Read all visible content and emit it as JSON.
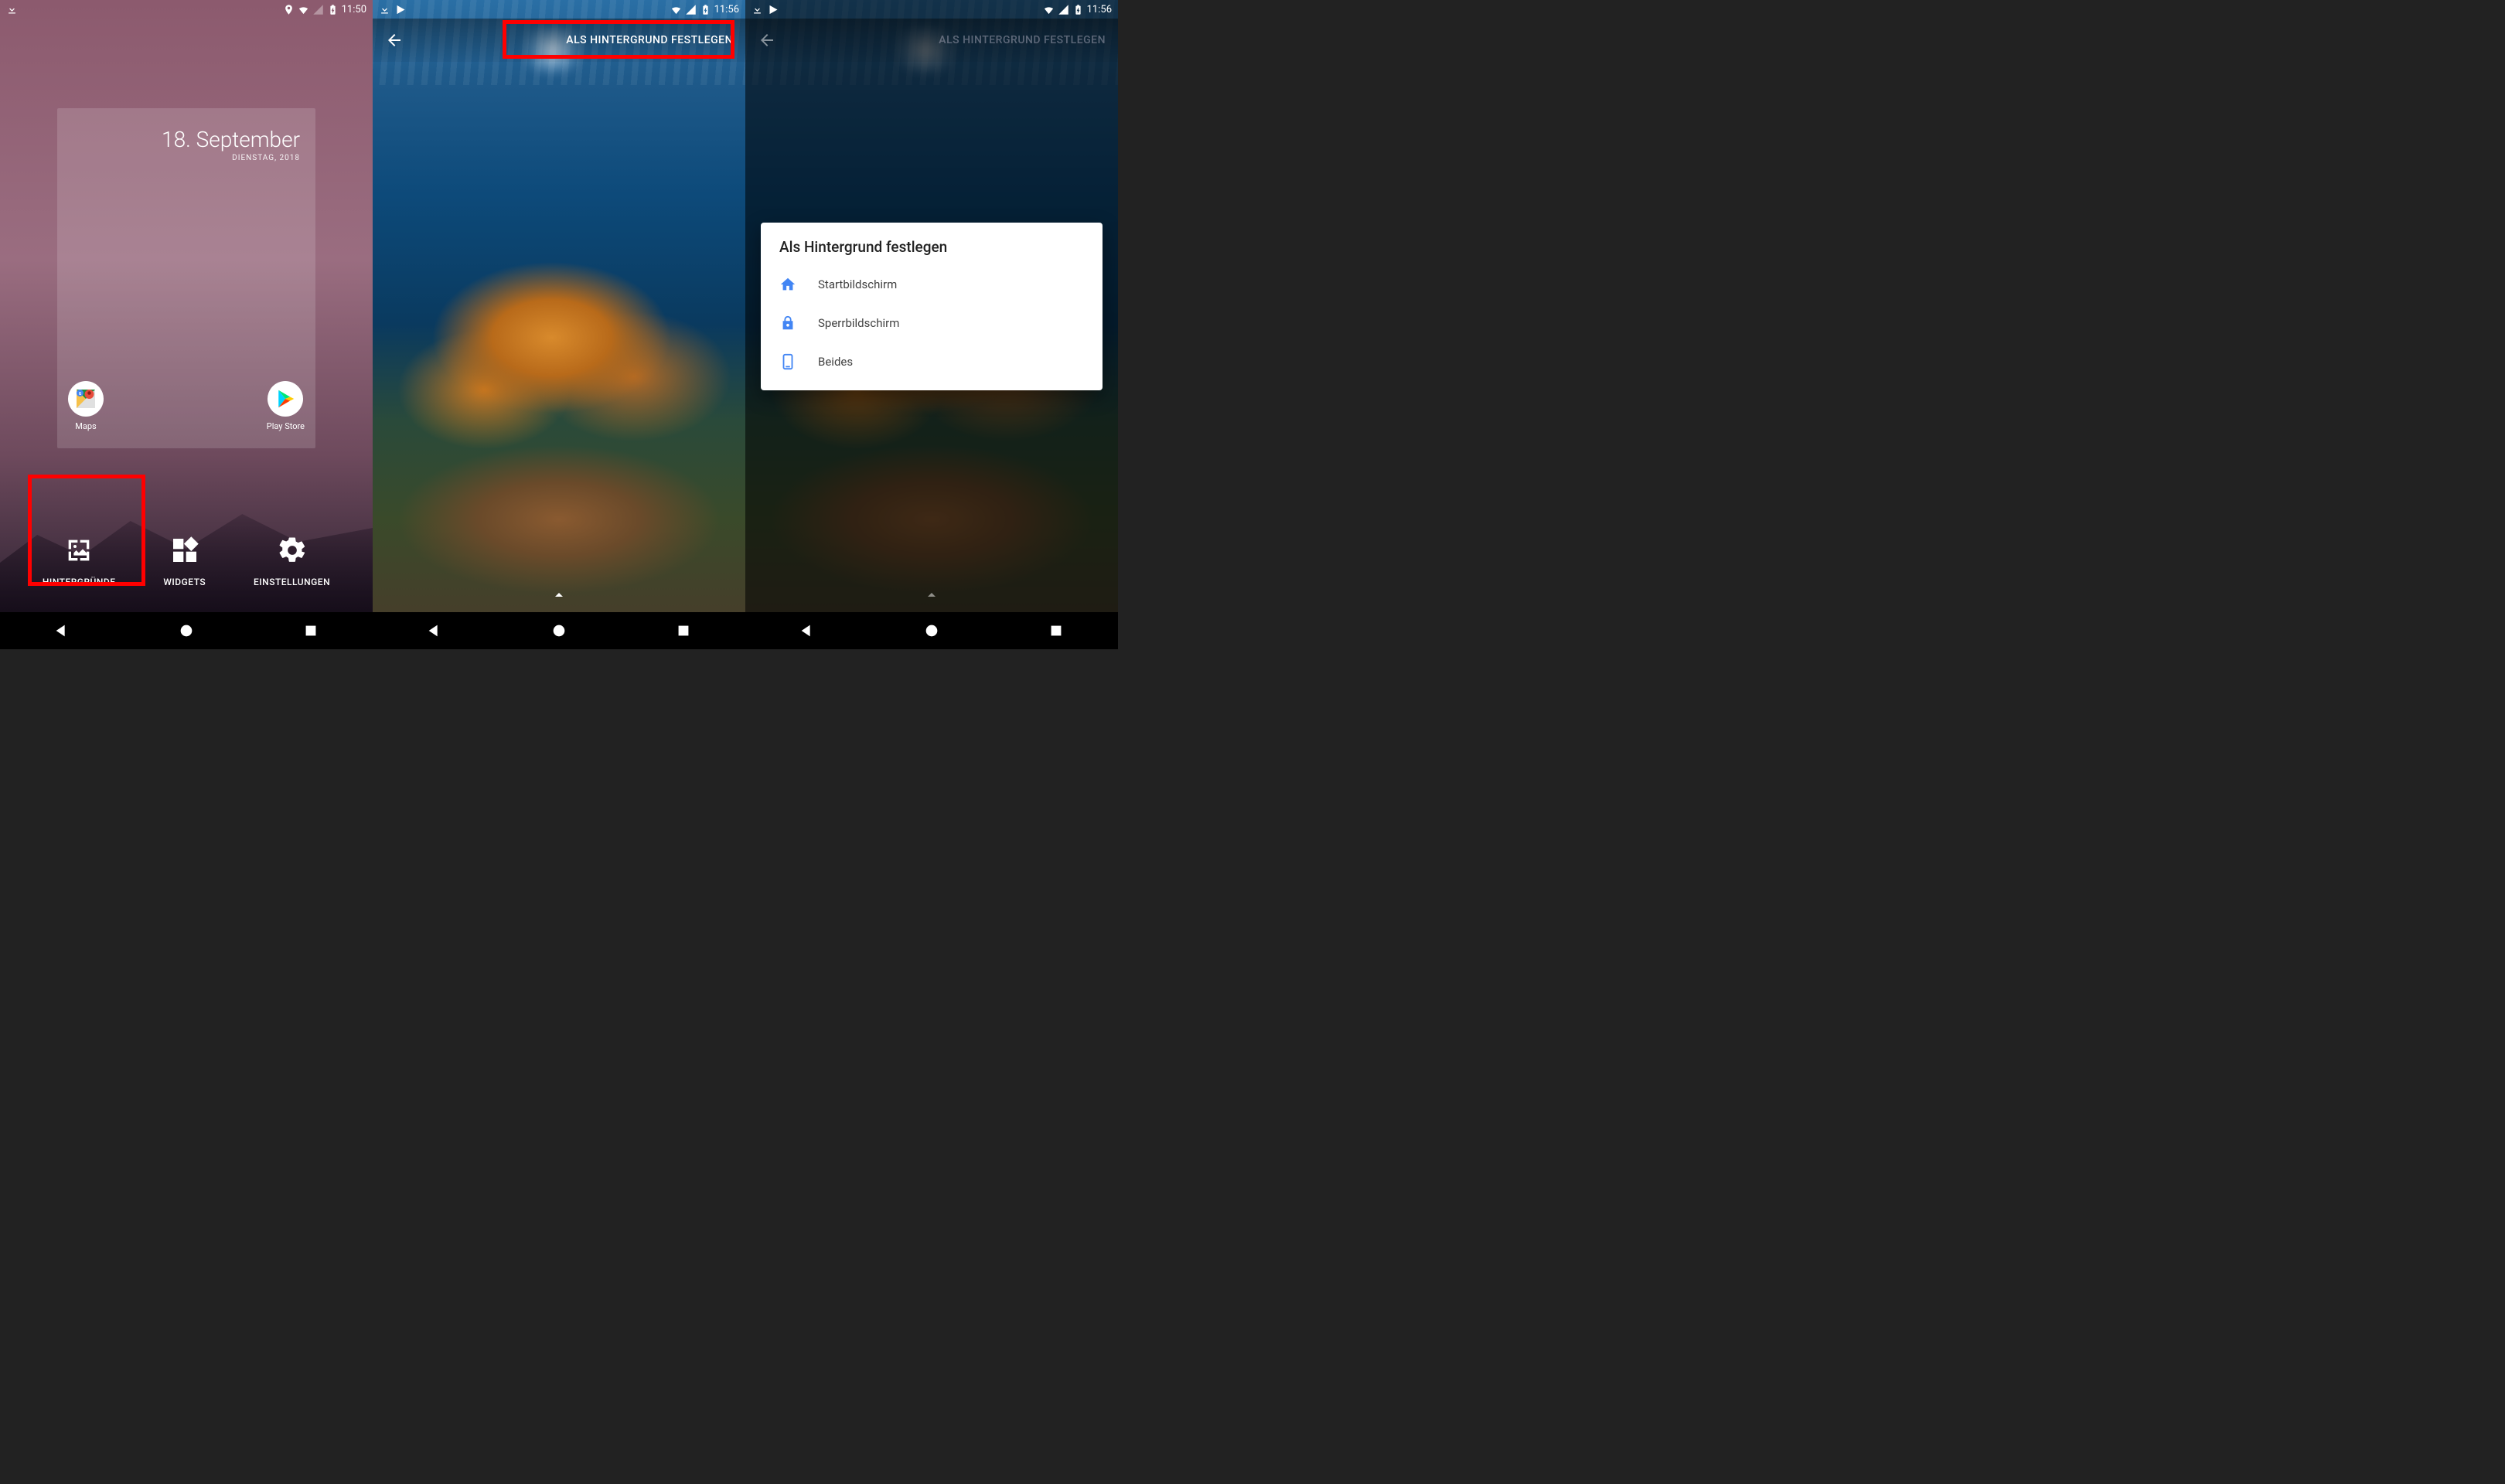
{
  "screen1": {
    "status": {
      "time": "11:50"
    },
    "widget": {
      "date": "18. September",
      "sub": "DIENSTAG, 2018"
    },
    "apps": {
      "maps": "Maps",
      "playstore": "Play Store"
    },
    "options": {
      "wallpapers": "HINTERGRÜNDE",
      "widgets": "WIDGETS",
      "settings": "EINSTELLUNGEN"
    }
  },
  "screen2": {
    "status": {
      "time": "11:56"
    },
    "appbar": {
      "title": "ALS HINTERGRUND FESTLEGEN"
    }
  },
  "screen3": {
    "status": {
      "time": "11:56"
    },
    "appbar": {
      "title": "ALS HINTERGRUND FESTLEGEN"
    },
    "dialog": {
      "title": "Als Hintergrund festlegen",
      "home": "Startbildschirm",
      "lock": "Sperrbildschirm",
      "both": "Beides"
    }
  },
  "colors": {
    "highlight": "#ff0000",
    "accent_blue": "#4285f4"
  }
}
